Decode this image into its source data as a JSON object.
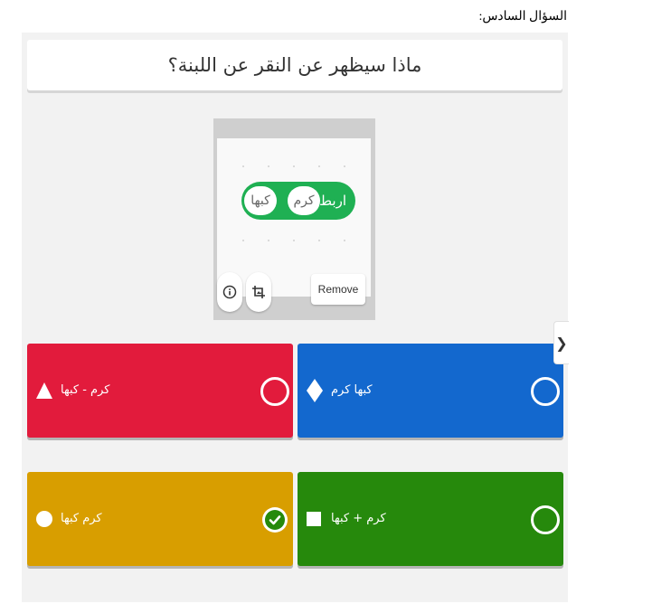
{
  "doc_heading": "السؤال السادس:",
  "question": {
    "text": "ماذا سيظهر عن النقر عن اللبنة؟"
  },
  "image": {
    "block_label": "اربط",
    "pill_1": "كرم",
    "pill_2": "كبها",
    "info_icon": "info-icon",
    "crop_icon": "crop-icon",
    "remove_label": "Remove"
  },
  "nav": {
    "arrow_icon": "chevron-right-icon",
    "arrow_glyph": "❯"
  },
  "answers": [
    {
      "color": "#e21b3c",
      "shape": "triangle",
      "label": "كرم - كبها",
      "selected": false
    },
    {
      "color": "#1368ce",
      "shape": "diamond",
      "label": "كبها كرم",
      "selected": false
    },
    {
      "color": "#d89e00",
      "shape": "circle",
      "label": "كرم كبها",
      "selected": true
    },
    {
      "color": "#26890c",
      "shape": "square",
      "label": "كرم + كبها",
      "selected": false
    }
  ]
}
